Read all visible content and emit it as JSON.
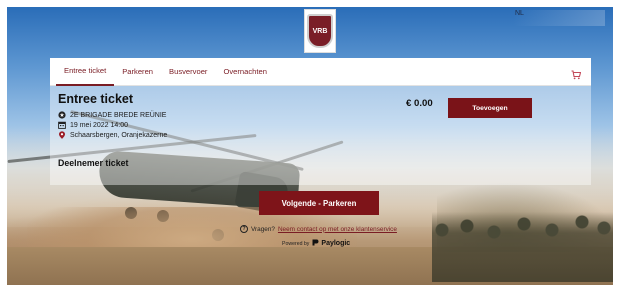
{
  "header": {
    "logo_text": "VRB",
    "language": "NL"
  },
  "tabs": [
    {
      "label": "Entree ticket",
      "active": true
    },
    {
      "label": "Parkeren",
      "active": false
    },
    {
      "label": "Busvervoer",
      "active": false
    },
    {
      "label": "Overnachten",
      "active": false
    }
  ],
  "event": {
    "title": "Entree ticket",
    "name": "2E BRIGADE BREDE REÜNIE",
    "datetime": "19 mei 2022 14:00",
    "location": "Schaarsbergen, Oranjekazerne"
  },
  "ticket": {
    "label": "Deelnemer ticket",
    "price": "€ 0.00",
    "add_label": "Toevoegen"
  },
  "next_label": "Volgende - Parkeren",
  "help": {
    "question": "Vragen?",
    "link": "Neem contact op met onze klantenservice"
  },
  "powered": {
    "prefix": "Powered by",
    "brand": "Paylogic"
  },
  "colors": {
    "accent": "#7a1318"
  },
  "icons": {
    "cart": "cart-icon",
    "event": "star-circle-icon",
    "date": "calendar-icon",
    "location": "map-pin-icon",
    "help": "question-circle-icon",
    "brand": "paylogic-logo-icon"
  }
}
